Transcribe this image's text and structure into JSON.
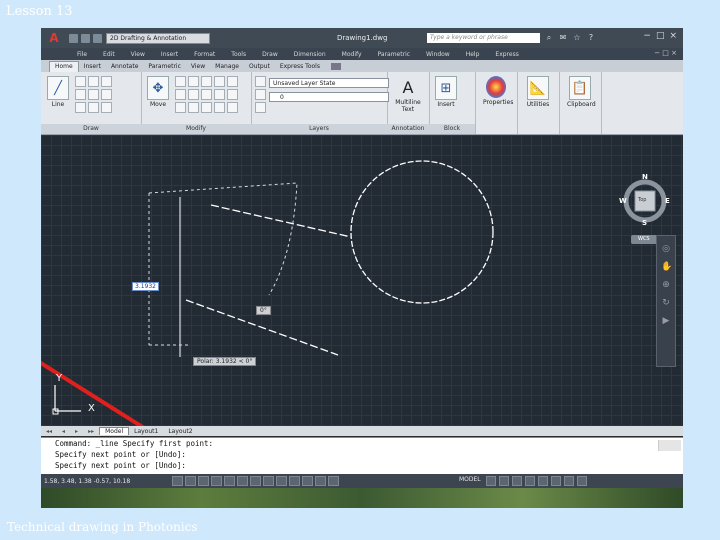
{
  "slide": {
    "title": "Lesson 13",
    "footer": "Technical drawing in Photonics"
  },
  "window": {
    "app_button": "A",
    "workspace": "2D Drafting & Annotation",
    "document_title": "Drawing1.dwg",
    "search_placeholder": "Type a keyword or phrase"
  },
  "menu": {
    "items": [
      "File",
      "Edit",
      "View",
      "Insert",
      "Format",
      "Tools",
      "Draw",
      "Dimension",
      "Modify",
      "Parametric",
      "Window",
      "Help",
      "Express"
    ]
  },
  "ribbon_tabs": [
    "Home",
    "Insert",
    "Annotate",
    "Parametric",
    "View",
    "Manage",
    "Output",
    "Express Tools"
  ],
  "ribbon": {
    "line_label": "Line",
    "move_label": "Move",
    "layer_state": "Unsaved Layer State",
    "layer_current": "0",
    "multiline_text_label": "Multiline Text",
    "insert_label": "Insert",
    "properties_label": "Properties",
    "utilities_label": "Utilities",
    "clipboard_label": "Clipboard",
    "panels": {
      "draw": "Draw",
      "modify": "Modify",
      "layers": "Layers",
      "annotation": "Annotation",
      "block": "Block"
    }
  },
  "viewcube": {
    "north": "N",
    "south": "S",
    "east": "E",
    "west": "W",
    "face": "Top",
    "wcs": "WCS"
  },
  "drawing": {
    "distance_tooltip": "3.1932",
    "angle_tooltip": "0°",
    "polar_tooltip": "Polar: 3.1932 < 0°",
    "ucs_x": "X",
    "ucs_y": "Y"
  },
  "layout_tabs": {
    "model": "Model",
    "layout1": "Layout1",
    "layout2": "Layout2"
  },
  "command_line": [
    "Command: _line Specify first point:",
    "Specify next point or [Undo]:",
    "Specify next point or [Undo]:"
  ],
  "status": {
    "coordinates": "1.58, 3.48, 1.38 -0.57, 10.18",
    "mode": "MODEL"
  }
}
